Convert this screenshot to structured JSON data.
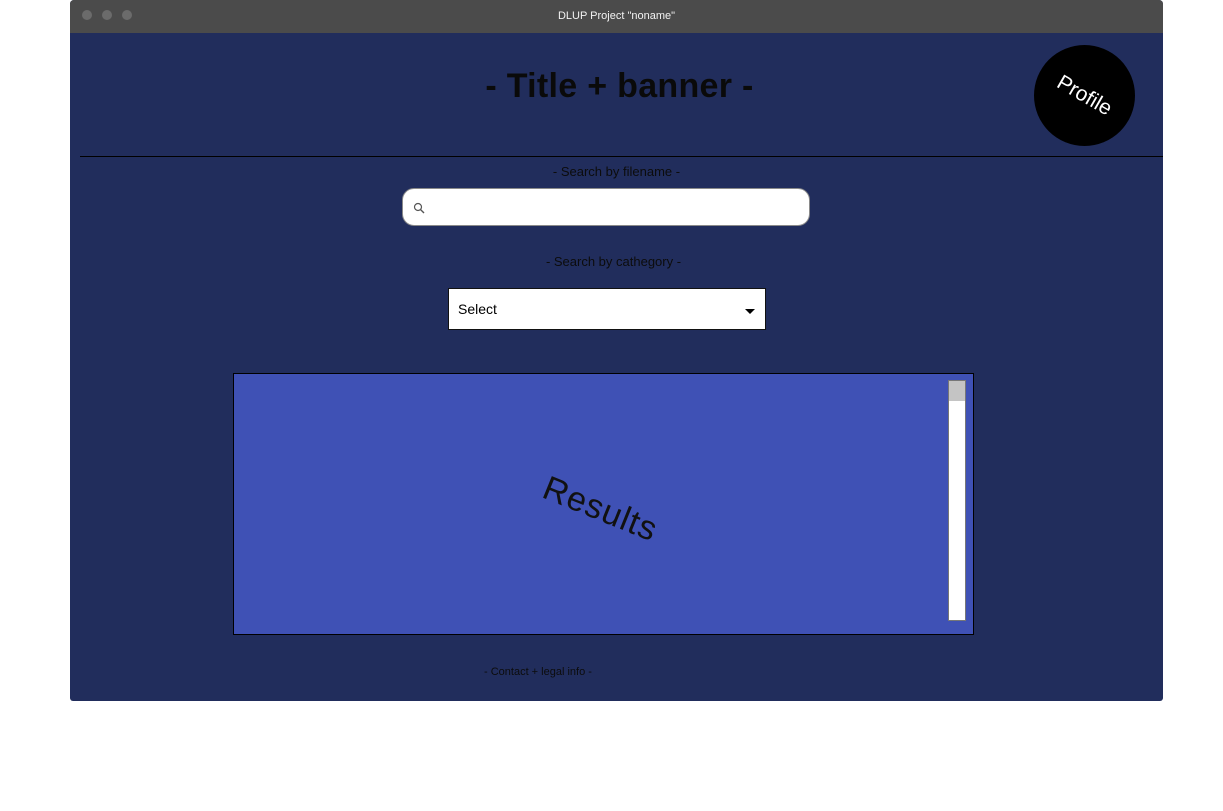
{
  "window": {
    "title": "DLUP Project \"noname\""
  },
  "header": {
    "banner_text": "- Title + banner -",
    "profile_label": "Profile"
  },
  "search": {
    "filename_label": "- Search by filename -",
    "filename_value": "",
    "filename_placeholder": "",
    "category_label": "- Search by cathegory -",
    "category_selected": "Select"
  },
  "results": {
    "label": "Results"
  },
  "footer": {
    "text": "- Contact + legal info -"
  },
  "colors": {
    "background": "#212d5c",
    "titlebar": "#4b4b4b",
    "results_panel": "#3f51b5",
    "profile_circle": "#000000"
  }
}
